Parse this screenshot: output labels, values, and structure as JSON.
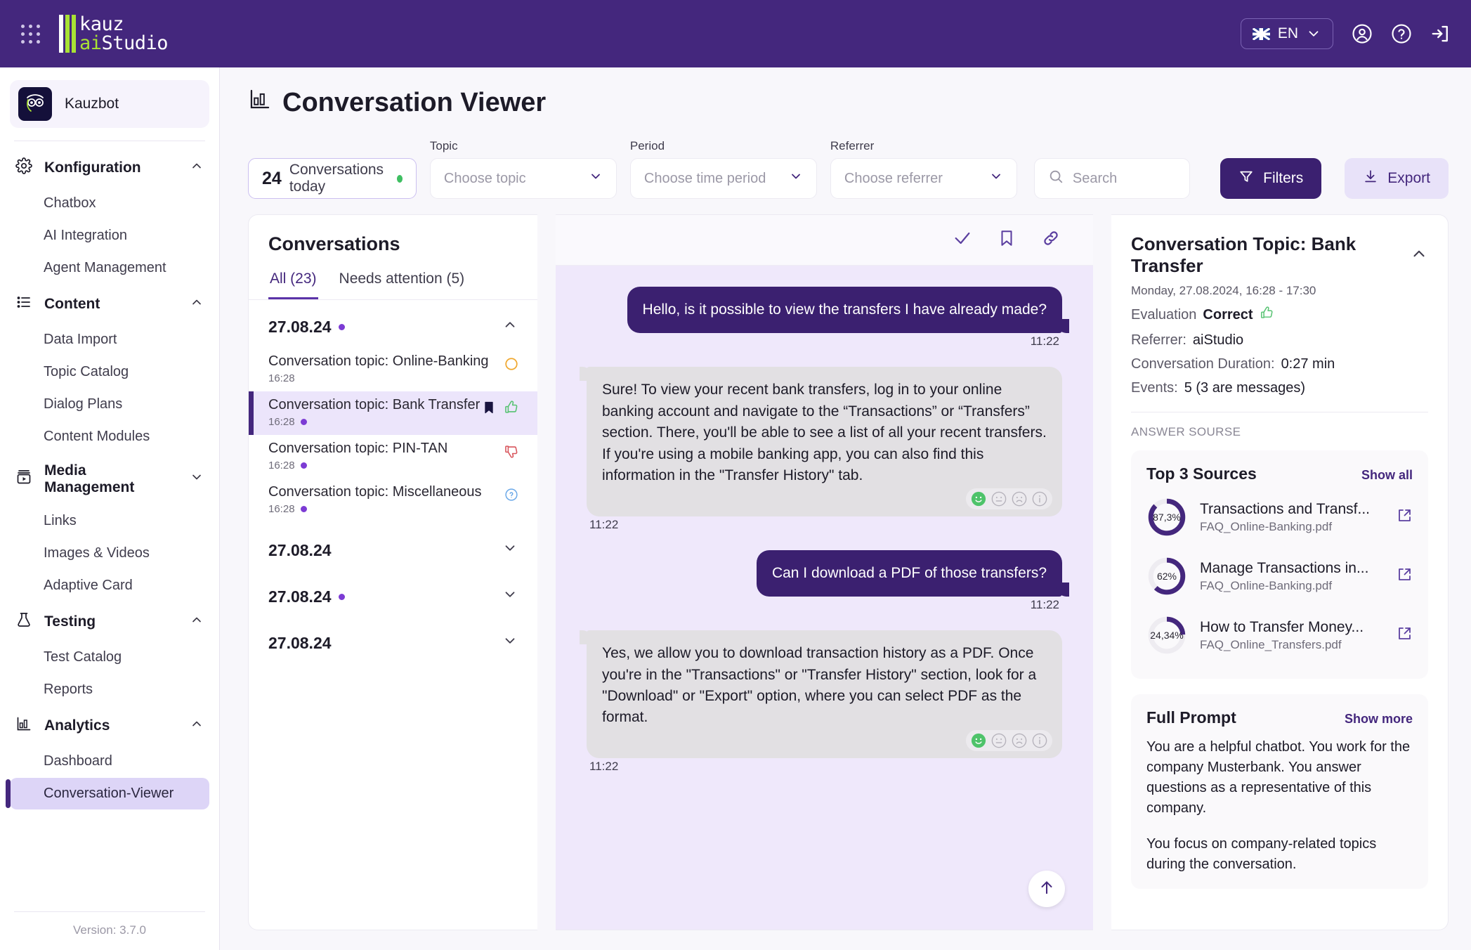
{
  "topbar": {
    "apps_icon": "grid-apps-icon",
    "logo_line1": "kauz",
    "logo_line2_hl": "ai",
    "logo_line2": "Studio",
    "language": "EN",
    "account_icon": "account-circle-icon",
    "help_icon": "help-circle-icon",
    "logout_icon": "logout-icon"
  },
  "sidebar": {
    "bot_name": "Kauzbot",
    "version": "Version: 3.7.0",
    "groups": [
      {
        "label": "Konfiguration",
        "icon": "gear-icon",
        "expanded": true,
        "items": [
          "Chatbox",
          "AI Integration",
          "Agent Management"
        ]
      },
      {
        "label": "Content",
        "icon": "list-icon",
        "expanded": true,
        "items": [
          "Data Import",
          "Topic Catalog",
          "Dialog Plans",
          "Content Modules"
        ]
      },
      {
        "label": "Media Management",
        "icon": "media-icon",
        "expanded": false,
        "items": [
          "Links",
          "Images & Videos",
          "Adaptive Card"
        ]
      },
      {
        "label": "Testing",
        "icon": "flask-icon",
        "expanded": true,
        "items": [
          "Test Catalog",
          "Reports"
        ]
      },
      {
        "label": "Analytics",
        "icon": "bar-chart-icon",
        "expanded": true,
        "items": [
          "Dashboard",
          "Conversation-Viewer"
        ]
      }
    ],
    "active_item": "Conversation-Viewer"
  },
  "page": {
    "title": "Conversation Viewer",
    "title_icon": "bar-chart-icon"
  },
  "filters": {
    "stat_number": "24",
    "stat_label": "Conversations today",
    "topic_label": "Topic",
    "topic_placeholder": "Choose topic",
    "period_label": "Period",
    "period_placeholder": "Choose time period",
    "referrer_label": "Referrer",
    "referrer_placeholder": "Choose referrer",
    "search_placeholder": "Search",
    "filters_button": "Filters",
    "export_button": "Export"
  },
  "conversations": {
    "header": "Conversations",
    "tabs": [
      {
        "label": "All (23)",
        "active": true
      },
      {
        "label": "Needs attention (5)",
        "active": false
      }
    ],
    "groups": [
      {
        "date": "27.08.24",
        "unread": true,
        "expanded": true,
        "items": [
          {
            "topic": "Conversation topic: Online-Banking",
            "time": "16:28",
            "unread": false,
            "status_icon": "pending-circle-icon",
            "bookmarked": false
          },
          {
            "topic": "Conversation topic: Bank Transfer",
            "time": "16:28",
            "unread": true,
            "status_icon": "thumbs-up-icon",
            "bookmarked": true,
            "selected": true
          },
          {
            "topic": "Conversation topic: PIN-TAN",
            "time": "16:28",
            "unread": true,
            "status_icon": "thumbs-down-icon",
            "bookmarked": false
          },
          {
            "topic": "Conversation topic: Miscellaneous",
            "time": "16:28",
            "unread": true,
            "status_icon": "question-circle-icon",
            "bookmarked": false
          }
        ]
      },
      {
        "date": "27.08.24",
        "unread": false,
        "expanded": false,
        "items": []
      },
      {
        "date": "27.08.24",
        "unread": true,
        "expanded": false,
        "items": []
      },
      {
        "date": "27.08.24",
        "unread": false,
        "expanded": false,
        "items": []
      }
    ]
  },
  "chat": {
    "toolbar": [
      {
        "icon": "check-icon",
        "name": "mark-reviewed-button"
      },
      {
        "icon": "bookmark-icon",
        "name": "bookmark-button"
      },
      {
        "icon": "link-icon",
        "name": "copy-link-button"
      }
    ],
    "messages": [
      {
        "from": "user",
        "text": "Hello, is it possible to view the transfers I have already made?",
        "time": "11:22",
        "reactions": false
      },
      {
        "from": "bot",
        "text": "Sure! To view your recent bank transfers, log in to your online banking account and navigate to the “Transactions” or “Transfers” section. There, you'll be able to see a list of all your recent transfers. If you're using a mobile banking app, you can also find this information in the \"Transfer History\" tab.",
        "time": "11:22",
        "reactions": true
      },
      {
        "from": "user",
        "text": "Can I download a PDF of those transfers?",
        "time": "11:22",
        "reactions": false
      },
      {
        "from": "bot",
        "text": "Yes, we allow you to download transaction history as a PDF. Once you're in the \"Transactions\" or \"Transfer History\" section, look for a \"Download\" or \"Export\" option, where you can select PDF as the format.",
        "time": "11:22",
        "reactions": true
      }
    ],
    "reaction_icons": [
      "happy-face-icon",
      "neutral-face-icon",
      "sad-face-icon",
      "info-icon"
    ],
    "scroll_top_icon": "arrow-up-icon"
  },
  "detail": {
    "title": "Conversation Topic: Bank Transfer",
    "date": "Monday, 27.08.2024, 16:28 - 17:30",
    "evaluation_label": "Evaluation",
    "evaluation_value": "Correct",
    "evaluation_icon": "thumbs-up-icon",
    "referrer_label": "Referrer:",
    "referrer_value": "aiStudio",
    "duration_label": "Conversation Duration:",
    "duration_value": "0:27 min",
    "events_label": "Events:",
    "events_value": "5 (3 are messages)",
    "section_label": "ANSWER SOURSE",
    "sources_title": "Top 3 Sources",
    "sources_link": "Show all",
    "sources": [
      {
        "percent_label": "87,3%",
        "percent": 87.3,
        "title": "Transactions and Transf...",
        "file": "FAQ_Online-Banking.pdf",
        "open_icon": "external-link-icon"
      },
      {
        "percent_label": "62%",
        "percent": 62,
        "title": "Manage Transactions in...",
        "file": "FAQ_Online-Banking.pdf",
        "open_icon": "external-link-icon"
      },
      {
        "percent_label": "24,34%",
        "percent": 24.34,
        "title": "How to Transfer Money...",
        "file": "FAQ_Online_Transfers.pdf",
        "open_icon": "external-link-icon"
      }
    ],
    "prompt_title": "Full Prompt",
    "prompt_link": "Show more",
    "prompt_p1": "You are a helpful chatbot.  You work for the company Musterbank. You answer questions as a representative of this company.",
    "prompt_p2": "You focus on company-related topics during the conversation."
  },
  "colors": {
    "brand": "#44277d",
    "accent_green": "#a9e234",
    "selected_bg": "#ece5fb",
    "chat_bg": "#efe8fb"
  }
}
